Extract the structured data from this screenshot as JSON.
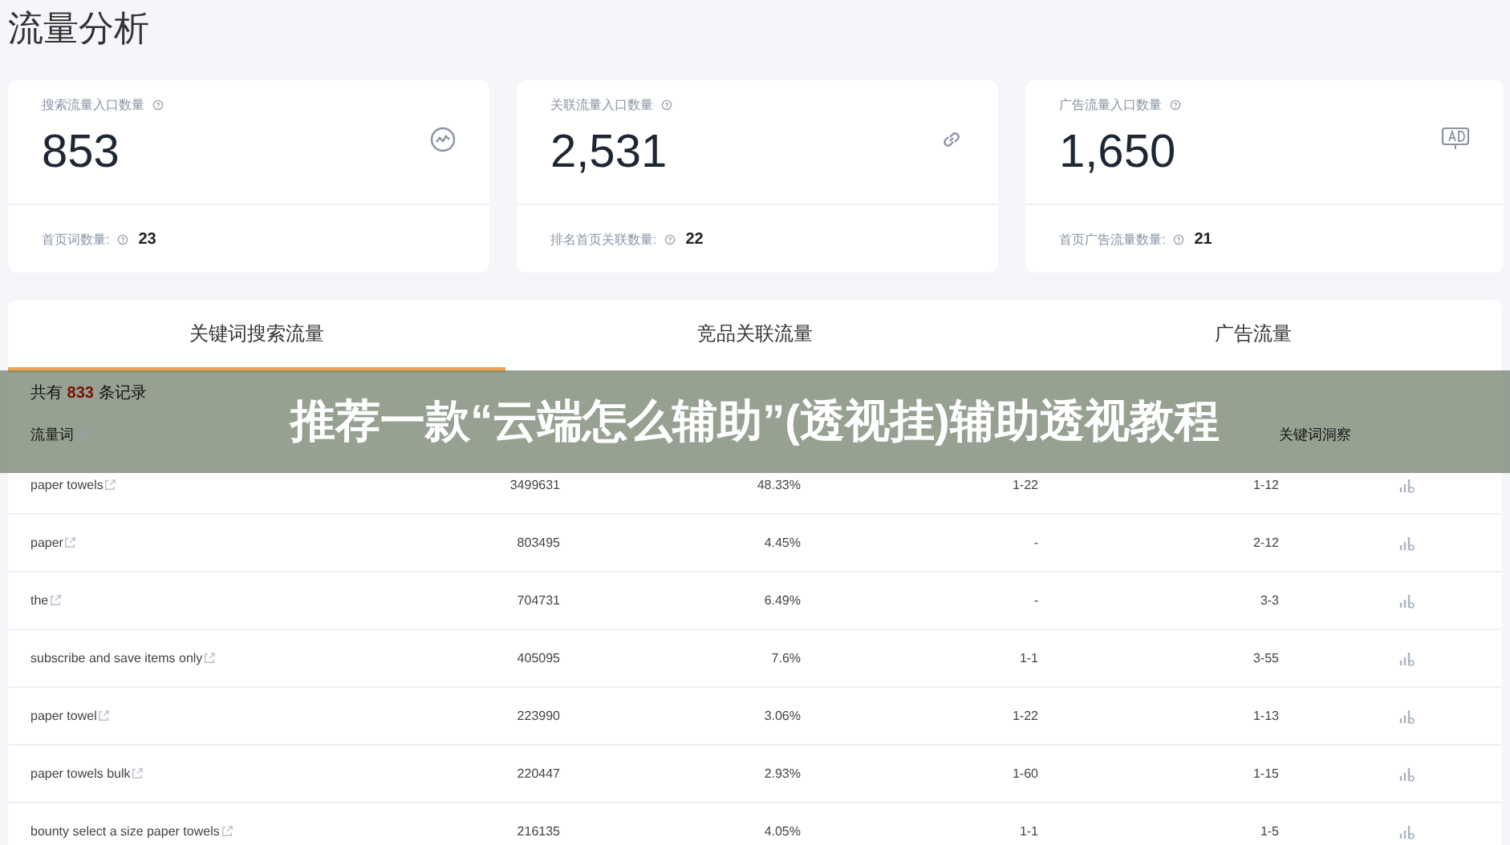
{
  "page_title": "流量分析",
  "cards": [
    {
      "label": "搜索流量入口数量",
      "value": "853",
      "kind": "trend",
      "footer_label": "首页词数量:",
      "footer_value": "23"
    },
    {
      "label": "关联流量入口数量",
      "value": "2,531",
      "kind": "link",
      "footer_label": "排名首页关联数量:",
      "footer_value": "22"
    },
    {
      "label": "广告流量入口数量",
      "value": "1,650",
      "kind": "ad",
      "footer_label": "首页广告流量数量:",
      "footer_value": "21"
    }
  ],
  "tabs": [
    {
      "label": "关键词搜索流量",
      "selected": true
    },
    {
      "label": "竞品关联流量",
      "selected": false
    },
    {
      "label": "广告流量",
      "selected": false
    }
  ],
  "record_count": {
    "prefix": "共有",
    "count": "833",
    "suffix": "条记录"
  },
  "table": {
    "columns": [
      {
        "label": "流量词"
      },
      {},
      {},
      {},
      {},
      {
        "label": "关键词洞察"
      }
    ],
    "rows": [
      {
        "keyword": "paper towels",
        "volume": "3499631",
        "share": "48.33%",
        "column_4": "1-22",
        "column_5": "1-12"
      },
      {
        "keyword": "paper",
        "volume": "803495",
        "share": "4.45%",
        "column_4": "-",
        "column_5": "2-12"
      },
      {
        "keyword": "the",
        "volume": "704731",
        "share": "6.49%",
        "column_4": "-",
        "column_5": "3-3"
      },
      {
        "keyword": "subscribe and save items only",
        "volume": "405095",
        "share": "7.6%",
        "column_4": "1-1",
        "column_5": "3-55"
      },
      {
        "keyword": "paper towel",
        "volume": "223990",
        "share": "3.06%",
        "column_4": "1-22",
        "column_5": "1-13"
      },
      {
        "keyword": "paper towels bulk",
        "volume": "220447",
        "share": "2.93%",
        "column_4": "1-60",
        "column_5": "1-15"
      },
      {
        "keyword": "bounty select a size paper towels",
        "volume": "216135",
        "share": "4.05%",
        "column_4": "1-1",
        "column_5": "1-5"
      }
    ]
  },
  "banner": "推荐一款“云端怎么辅助”(透视挂)辅助透视教程"
}
